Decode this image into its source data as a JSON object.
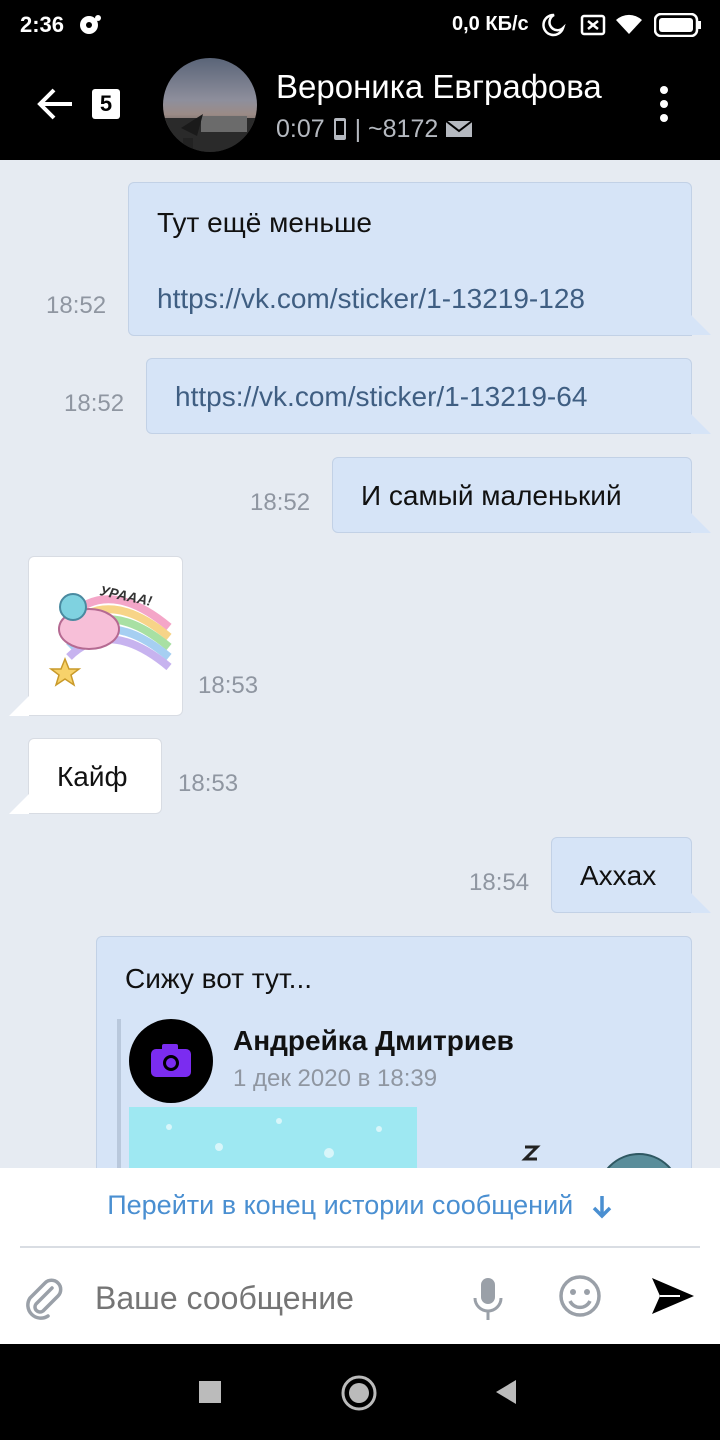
{
  "status_bar": {
    "time": "2:36",
    "network_speed": "0,0 КБ/с",
    "icons": [
      "messenger-icon",
      "moon-icon",
      "sim-icon",
      "wifi-icon",
      "battery-icon"
    ]
  },
  "header": {
    "badge_count": "5",
    "contact_name": "Вероника Евграфова",
    "last_seen": "0:07",
    "sub_separator": "|",
    "message_id": "~8172"
  },
  "messages": [
    {
      "direction": "out",
      "text": "Тут ещё меньше",
      "link": "https://vk.com/sticker/1-13219-128",
      "time": "18:52"
    },
    {
      "direction": "out",
      "link": "https://vk.com/sticker/1-13219-64",
      "time": "18:52"
    },
    {
      "direction": "out",
      "text": "И самый маленький",
      "time": "18:52"
    },
    {
      "direction": "in",
      "sticker": "sticker-unicorn",
      "sticker_text": "УРААА!",
      "time": "18:53"
    },
    {
      "direction": "in",
      "text": "Кайф",
      "time": "18:53"
    },
    {
      "direction": "out",
      "text": "Ахxах",
      "time": "18:54"
    },
    {
      "direction": "out",
      "text": "Сижу вот тут...",
      "repost_author": "Андрейка Дмитриев",
      "repost_date": "1 дек 2020 в 18:39"
    }
  ],
  "bottom": {
    "jump_label": "Перейти в конец истории сообщений",
    "input_placeholder": "Ваше сообщение"
  },
  "colors": {
    "chat_bg": "#e6ebf2",
    "out_bubble": "#d6e4f7",
    "in_bubble": "#ffffff",
    "accent": "#4a8fd1",
    "header_bg": "#000000"
  }
}
